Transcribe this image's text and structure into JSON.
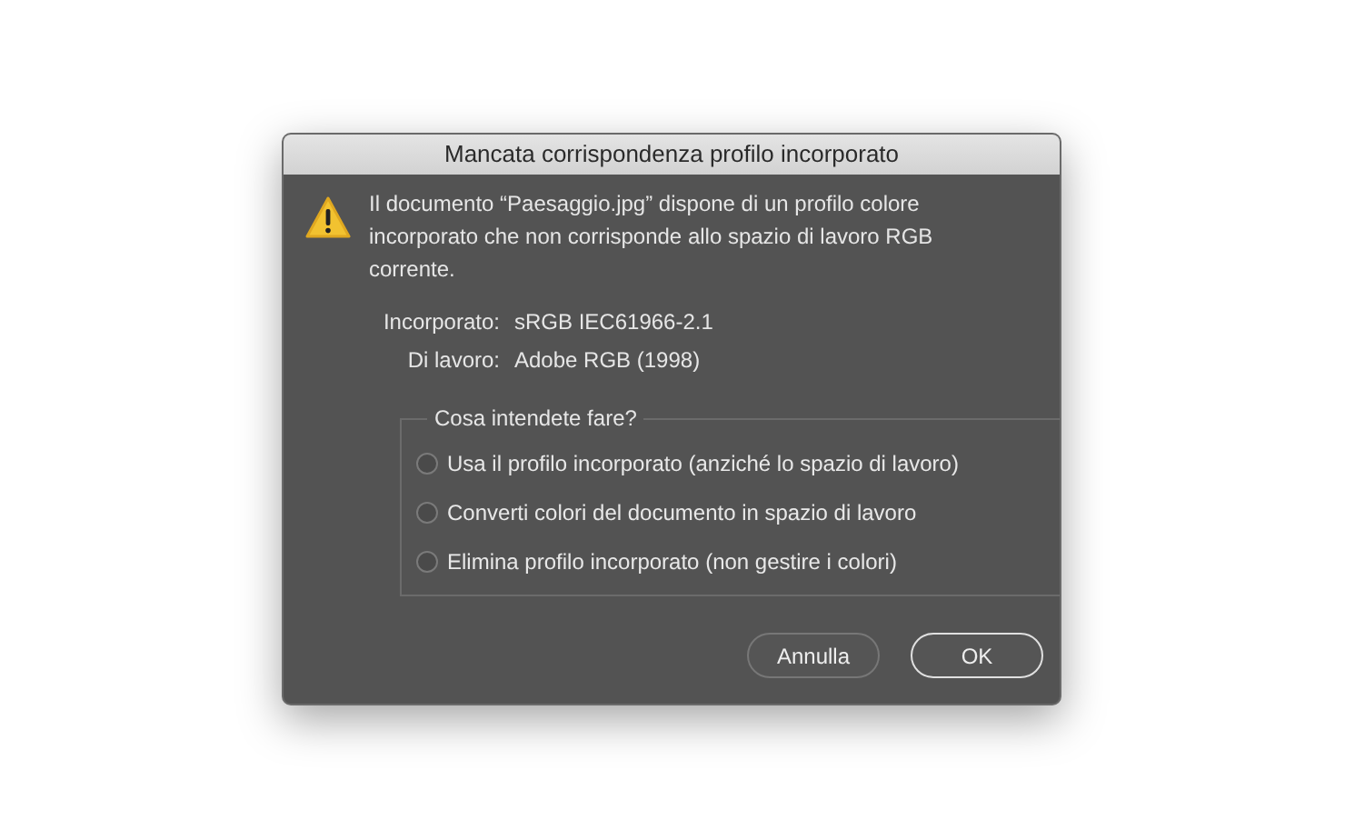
{
  "window": {
    "title": "Mancata corrispondenza profilo incorporato"
  },
  "message": "Il documento “Paesaggio.jpg” dispone di un profilo colore incorporato che non corrisponde allo spazio di lavoro RGB corrente.",
  "profiles": [
    {
      "label": "Incorporato:",
      "value": "sRGB IEC61966-2.1"
    },
    {
      "label": "Di lavoro:",
      "value": "Adobe RGB (1998)"
    }
  ],
  "choice": {
    "legend": "Cosa intendete fare?",
    "options": [
      {
        "label": "Usa il profilo incorporato (anziché lo spazio di lavoro)",
        "selected": false
      },
      {
        "label": "Converti colori del documento in spazio di lavoro",
        "selected": false
      },
      {
        "label": "Elimina profilo incorporato (non gestire i colori)",
        "selected": false
      }
    ]
  },
  "buttons": [
    {
      "label": "Annulla",
      "default": false
    },
    {
      "label": "OK",
      "default": true
    }
  ]
}
